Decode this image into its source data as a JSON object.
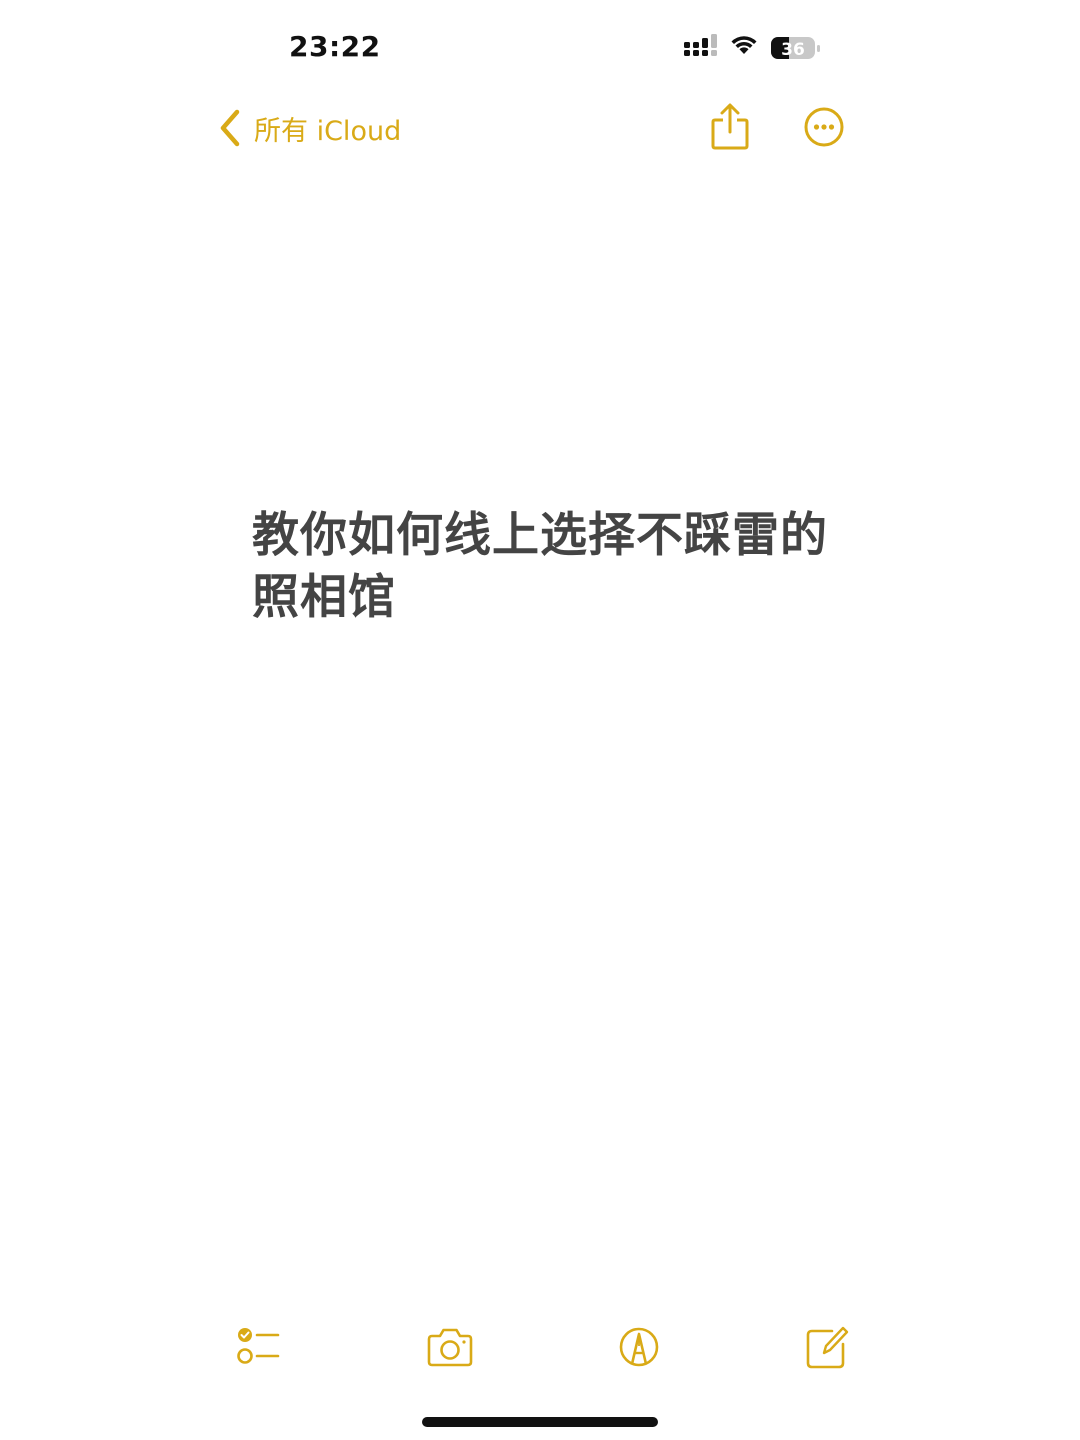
{
  "status_bar": {
    "time": "23:22",
    "battery_level": "36",
    "icons": [
      "cellular-signal-icon",
      "wifi-icon",
      "battery-icon"
    ]
  },
  "nav": {
    "back_label": "所有 iCloud",
    "back_icon": "chevron-left-icon",
    "share_icon": "share-icon",
    "more_icon": "ellipsis-circle-icon"
  },
  "note": {
    "title": "教你如何线上选择不踩雷的照相馆"
  },
  "toolbar": {
    "items": [
      {
        "icon": "checklist-icon"
      },
      {
        "icon": "camera-icon"
      },
      {
        "icon": "markup-pen-icon"
      },
      {
        "icon": "compose-icon"
      }
    ]
  },
  "colors": {
    "accent": "#d9aa17",
    "title_text": "#444444",
    "background": "#ffffff"
  }
}
